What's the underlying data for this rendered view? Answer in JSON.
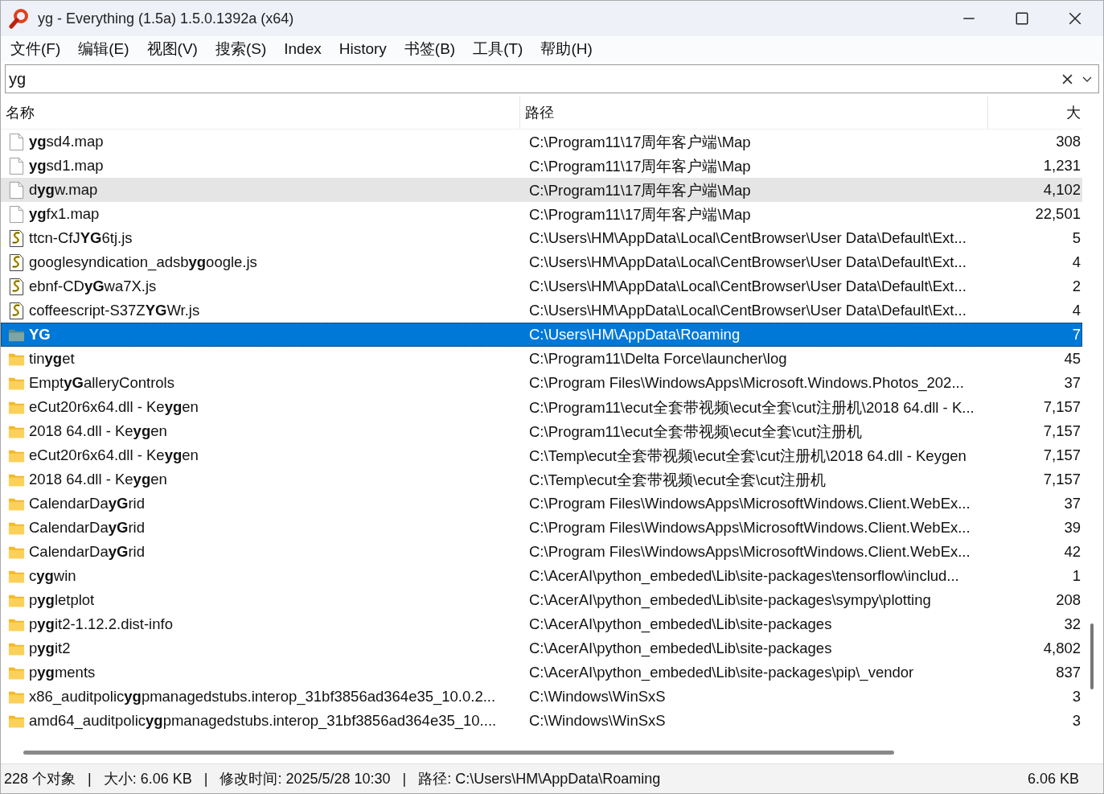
{
  "window": {
    "title": "yg - Everything (1.5a) 1.5.0.1392a (x64)"
  },
  "menu": [
    "文件(F)",
    "编辑(E)",
    "视图(V)",
    "搜索(S)",
    "Index",
    "History",
    "书签(B)",
    "工具(T)",
    "帮助(H)"
  ],
  "search": {
    "value": "yg"
  },
  "columns": [
    "名称",
    "路径",
    "大"
  ],
  "rows": [
    {
      "kind": "file",
      "name": "**yg**sd4.map",
      "path": "C:\\Program11\\17周年客户端\\Map",
      "size": "308",
      "selected": false,
      "hovered": false,
      "bold": false
    },
    {
      "kind": "file",
      "name": "**yg**sd1.map",
      "path": "C:\\Program11\\17周年客户端\\Map",
      "size": "1,231",
      "selected": false,
      "hovered": false,
      "bold": false
    },
    {
      "kind": "file",
      "name": "d**yg**w.map",
      "path": "C:\\Program11\\17周年客户端\\Map",
      "size": "4,102",
      "selected": false,
      "hovered": true,
      "bold": false
    },
    {
      "kind": "file",
      "name": "**yg**fx1.map",
      "path": "C:\\Program11\\17周年客户端\\Map",
      "size": "22,501",
      "selected": false,
      "hovered": false,
      "bold": false
    },
    {
      "kind": "script",
      "name": "ttcn-CfJ**YG**6tj.js",
      "path": "C:\\Users\\HM\\AppData\\Local\\CentBrowser\\User Data\\Default\\Ext...",
      "size": "5",
      "selected": false,
      "hovered": false,
      "bold": false
    },
    {
      "kind": "script",
      "name": "googlesyndication_adsb**yg**oogle.js",
      "path": "C:\\Users\\HM\\AppData\\Local\\CentBrowser\\User Data\\Default\\Ext...",
      "size": "4",
      "selected": false,
      "hovered": false,
      "bold": false
    },
    {
      "kind": "script",
      "name": "ebnf-CD**yG**wa7X.js",
      "path": "C:\\Users\\HM\\AppData\\Local\\CentBrowser\\User Data\\Default\\Ext...",
      "size": "2",
      "selected": false,
      "hovered": false,
      "bold": false
    },
    {
      "kind": "script",
      "name": "coffeescript-S37Z**YG**Wr.js",
      "path": "C:\\Users\\HM\\AppData\\Local\\CentBrowser\\User Data\\Default\\Ext...",
      "size": "4",
      "selected": false,
      "hovered": false,
      "bold": false
    },
    {
      "kind": "folder",
      "name": "YG",
      "path": "C:\\Users\\HM\\AppData\\Roaming",
      "size": "7",
      "selected": true,
      "hovered": false,
      "bold": true
    },
    {
      "kind": "folder",
      "name": "tin**yg**et",
      "path": "C:\\Program11\\Delta Force\\launcher\\log",
      "size": "45",
      "selected": false,
      "hovered": false,
      "bold": false
    },
    {
      "kind": "folder",
      "name": "Empt**yG**alleryControls",
      "path": "C:\\Program Files\\WindowsApps\\Microsoft.Windows.Photos_202...",
      "size": "37",
      "selected": false,
      "hovered": false,
      "bold": false
    },
    {
      "kind": "folder",
      "name": "eCut20r6x64.dll - Ke**yg**en",
      "path": "C:\\Program11\\ecut全套带视频\\ecut全套\\cut注册机\\2018 64.dll - K...",
      "size": "7,157",
      "selected": false,
      "hovered": false,
      "bold": false
    },
    {
      "kind": "folder",
      "name": "2018 64.dll - Ke**yg**en",
      "path": "C:\\Program11\\ecut全套带视频\\ecut全套\\cut注册机",
      "size": "7,157",
      "selected": false,
      "hovered": false,
      "bold": false
    },
    {
      "kind": "folder",
      "name": "eCut20r6x64.dll - Ke**yg**en",
      "path": "C:\\Temp\\ecut全套带视频\\ecut全套\\cut注册机\\2018 64.dll - Keygen",
      "size": "7,157",
      "selected": false,
      "hovered": false,
      "bold": false
    },
    {
      "kind": "folder",
      "name": "2018 64.dll - Ke**yg**en",
      "path": "C:\\Temp\\ecut全套带视频\\ecut全套\\cut注册机",
      "size": "7,157",
      "selected": false,
      "hovered": false,
      "bold": false
    },
    {
      "kind": "folder",
      "name": "CalendarDa**yG**rid",
      "path": "C:\\Program Files\\WindowsApps\\MicrosoftWindows.Client.WebEx...",
      "size": "37",
      "selected": false,
      "hovered": false,
      "bold": false
    },
    {
      "kind": "folder",
      "name": "CalendarDa**yG**rid",
      "path": "C:\\Program Files\\WindowsApps\\MicrosoftWindows.Client.WebEx...",
      "size": "39",
      "selected": false,
      "hovered": false,
      "bold": false
    },
    {
      "kind": "folder",
      "name": "CalendarDa**yG**rid",
      "path": "C:\\Program Files\\WindowsApps\\MicrosoftWindows.Client.WebEx...",
      "size": "42",
      "selected": false,
      "hovered": false,
      "bold": false
    },
    {
      "kind": "folder",
      "name": "c**yg**win",
      "path": "C:\\AcerAI\\python_embeded\\Lib\\site-packages\\tensorflow\\includ...",
      "size": "1",
      "selected": false,
      "hovered": false,
      "bold": false
    },
    {
      "kind": "folder",
      "name": "p**yg**letplot",
      "path": "C:\\AcerAI\\python_embeded\\Lib\\site-packages\\sympy\\plotting",
      "size": "208",
      "selected": false,
      "hovered": false,
      "bold": false
    },
    {
      "kind": "folder",
      "name": "p**yg**it2-1.12.2.dist-info",
      "path": "C:\\AcerAI\\python_embeded\\Lib\\site-packages",
      "size": "32",
      "selected": false,
      "hovered": false,
      "bold": false
    },
    {
      "kind": "folder",
      "name": "p**yg**it2",
      "path": "C:\\AcerAI\\python_embeded\\Lib\\site-packages",
      "size": "4,802",
      "selected": false,
      "hovered": false,
      "bold": false
    },
    {
      "kind": "folder",
      "name": "p**yg**ments",
      "path": "C:\\AcerAI\\python_embeded\\Lib\\site-packages\\pip\\_vendor",
      "size": "837",
      "selected": false,
      "hovered": false,
      "bold": false
    },
    {
      "kind": "folder",
      "name": "x86_auditpolic**yg**pmanagedstubs.interop_31bf3856ad364e35_10.0.2...",
      "path": "C:\\Windows\\WinSxS",
      "size": "3",
      "selected": false,
      "hovered": false,
      "bold": false
    },
    {
      "kind": "folder",
      "name": "amd64_auditpolic**yg**pmanagedstubs.interop_31bf3856ad364e35_10....",
      "path": "C:\\Windows\\WinSxS",
      "size": "3",
      "selected": false,
      "hovered": false,
      "bold": false
    }
  ],
  "status_bar": {
    "items": [
      "228 个对象",
      "|",
      "大小: 6.06 KB",
      "|",
      "修改时间: 2025/5/28 10:30",
      "|",
      "路径: C:\\Users\\HM\\AppData\\Roaming"
    ],
    "right": "6.06 KB"
  }
}
